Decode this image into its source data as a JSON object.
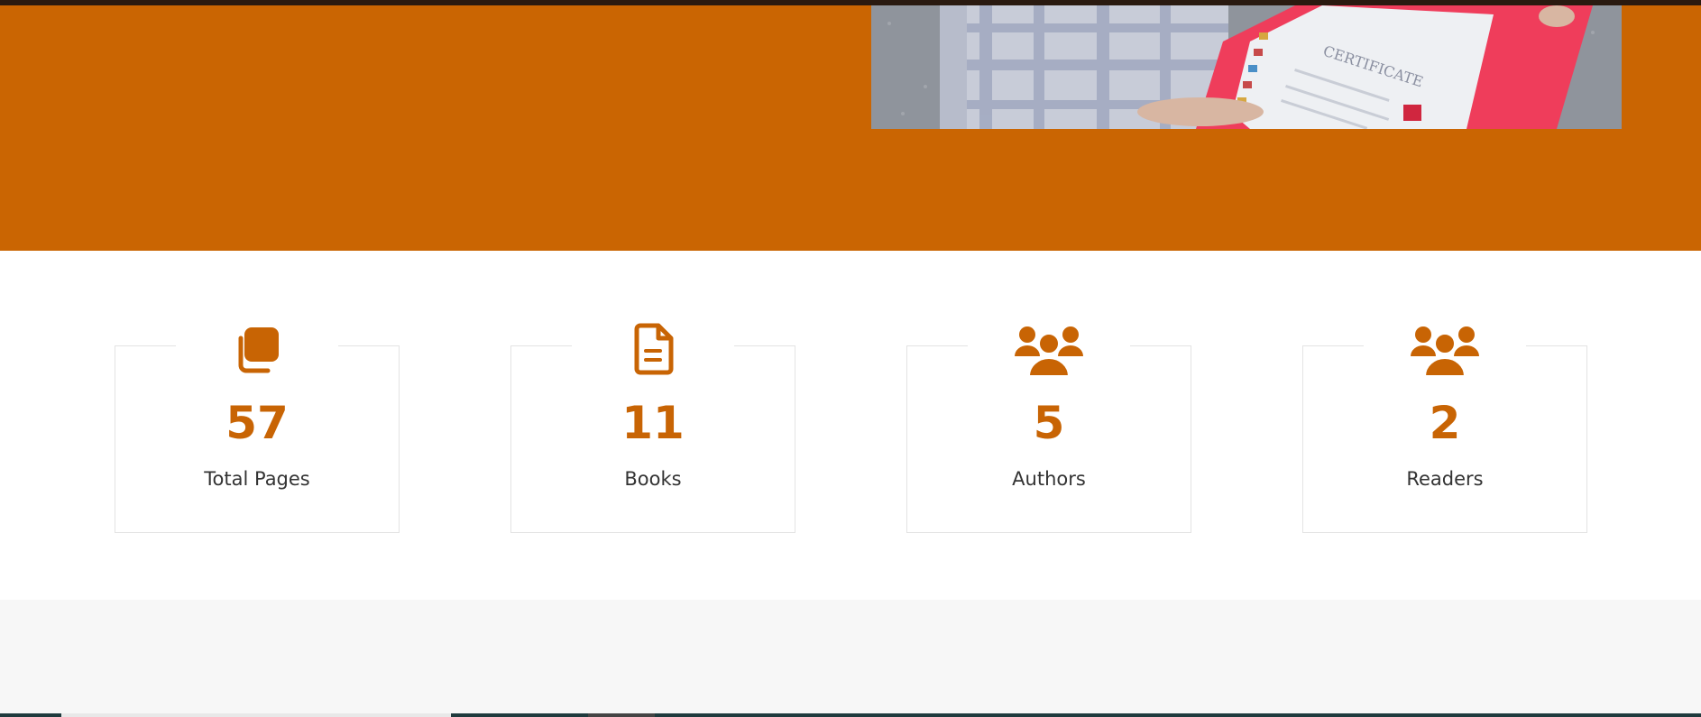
{
  "stats": [
    {
      "count": "57",
      "label": "Total Pages",
      "icon": "copy-icon"
    },
    {
      "count": "11",
      "label": "Books",
      "icon": "document-icon"
    },
    {
      "count": "5",
      "label": "Authors",
      "icon": "users-icon"
    },
    {
      "count": "2",
      "label": "Readers",
      "icon": "users-icon"
    }
  ],
  "colors": {
    "hero_bg": "#ca6502",
    "accent": "#c86404",
    "gray_band": "#f7f7f7"
  }
}
